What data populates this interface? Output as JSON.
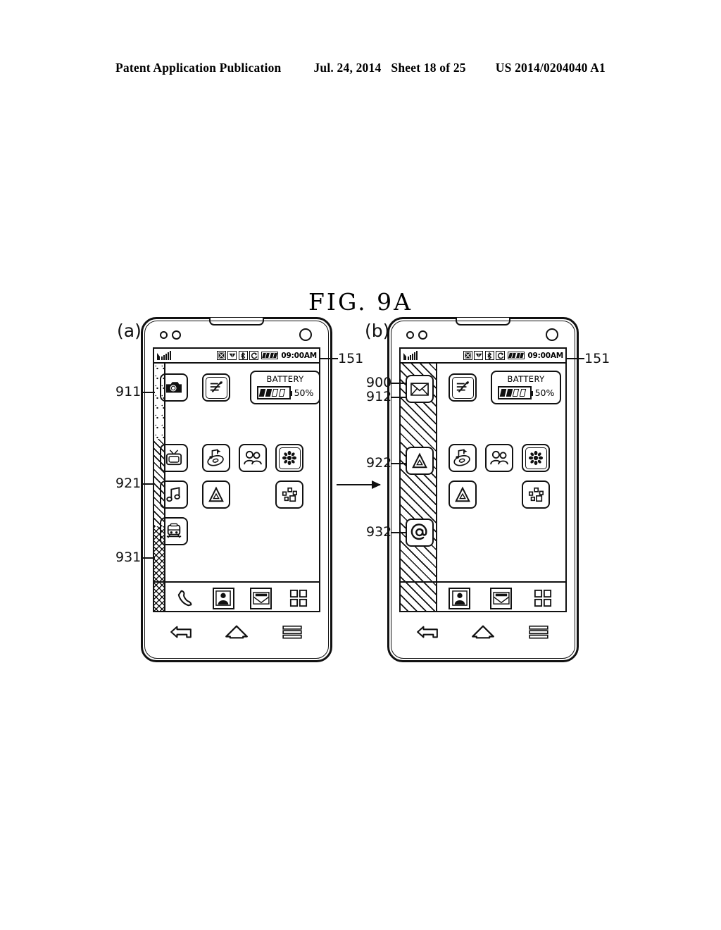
{
  "header": {
    "publication": "Patent Application Publication",
    "date": "Jul. 24, 2014",
    "sheet": "Sheet 18 of 25",
    "docnum": "US 2014/0204040 A1"
  },
  "figure": {
    "title": "FIG.  9A"
  },
  "panels": {
    "a": {
      "label": "(a)"
    },
    "b": {
      "label": "(b)"
    }
  },
  "status_bar": {
    "signal_icon": "signal-bars-icon",
    "icons": [
      {
        "name": "no-sim-icon",
        "glyph": "☒"
      },
      {
        "name": "wifi-icon",
        "glyph": "▼"
      },
      {
        "name": "bluetooth-icon",
        "glyph": "❇"
      },
      {
        "name": "sync-icon",
        "glyph": "⟳"
      }
    ],
    "battery_icon": "battery-icon",
    "time": "09:00AM"
  },
  "battery_widget": {
    "caption": "BATTERY",
    "percent": "50%",
    "filled_bars": 2,
    "empty_bars": 2
  },
  "phone_a": {
    "strip": {
      "segments": [
        {
          "name": "dots-segment",
          "ref": "911"
        },
        {
          "name": "diagonal-segment",
          "ref": "921"
        },
        {
          "name": "crosshatch-segment",
          "ref": "931"
        }
      ],
      "icons": [
        {
          "name": "camera-icon",
          "row": 1
        },
        {
          "name": "tv-icon",
          "row": 2
        },
        {
          "name": "music-note-icon",
          "row": 3
        },
        {
          "name": "train-icon",
          "row": 4
        }
      ]
    },
    "apps": [
      {
        "name": "notes-icon",
        "row": 1,
        "col": 2
      },
      {
        "name": "music-cd-icon",
        "row": 2,
        "col": 2
      },
      {
        "name": "contacts-group-icon",
        "row": 2,
        "col": 3
      },
      {
        "name": "gallery-flower-icon",
        "row": 2,
        "col": 4
      },
      {
        "name": "font-a-icon",
        "row": 3,
        "col": 2
      },
      {
        "name": "widgets-icon",
        "row": 3,
        "col": 4
      }
    ],
    "dock": [
      {
        "name": "phone-dial-icon"
      },
      {
        "name": "contacts-icon"
      },
      {
        "name": "email-icon"
      },
      {
        "name": "app-drawer-icon"
      }
    ]
  },
  "phone_b": {
    "strip": {
      "ref_panel": "900",
      "icons": [
        {
          "name": "envelope-icon",
          "ref": "912"
        },
        {
          "name": "font-a-icon",
          "ref": "922"
        },
        {
          "name": "at-sign-icon",
          "ref": "932"
        }
      ]
    },
    "apps": [
      {
        "name": "notes-icon",
        "row": 1,
        "col": 2
      },
      {
        "name": "music-cd-icon",
        "row": 2,
        "col": 2
      },
      {
        "name": "contacts-group-icon",
        "row": 2,
        "col": 3
      },
      {
        "name": "gallery-flower-icon",
        "row": 2,
        "col": 4
      },
      {
        "name": "font-a-icon",
        "row": 3,
        "col": 2
      },
      {
        "name": "widgets-icon",
        "row": 3,
        "col": 4
      }
    ],
    "dock": [
      {
        "name": "contacts-icon"
      },
      {
        "name": "email-icon"
      },
      {
        "name": "app-drawer-icon"
      }
    ]
  },
  "nav_bar": [
    {
      "name": "back-button"
    },
    {
      "name": "home-button"
    },
    {
      "name": "menu-button"
    }
  ],
  "refs": {
    "r151_a": "151",
    "r151_b": "151",
    "r911": "911",
    "r921": "921",
    "r931": "931",
    "r900": "900",
    "r912": "912",
    "r922": "922",
    "r932": "932"
  },
  "colors": {
    "ink": "#111111",
    "paper": "#ffffff"
  }
}
